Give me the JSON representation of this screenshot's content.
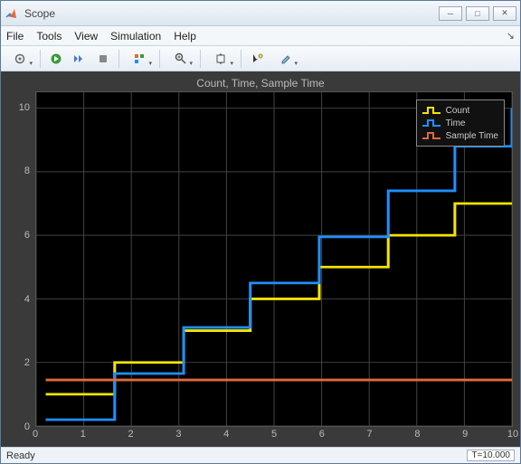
{
  "window": {
    "title": "Scope"
  },
  "menu": {
    "file": "File",
    "tools": "Tools",
    "view": "View",
    "simulation": "Simulation",
    "help": "Help"
  },
  "status": {
    "ready": "Ready",
    "time": "T=10.000"
  },
  "chart_data": {
    "type": "line",
    "title": "Count, Time, Sample Time",
    "xlabel": "",
    "ylabel": "",
    "xlim": [
      0,
      10
    ],
    "ylim": [
      0,
      10.5
    ],
    "xticks": [
      0,
      1,
      2,
      3,
      4,
      5,
      6,
      7,
      8,
      9,
      10
    ],
    "yticks": [
      0,
      2,
      4,
      6,
      8,
      10
    ],
    "legend_position": "top-right",
    "series": [
      {
        "name": "Count",
        "color": "#f4e400",
        "x": [
          0.2,
          1.65,
          1.65,
          3.1,
          3.1,
          4.5,
          4.5,
          5.95,
          5.95,
          7.4,
          7.4,
          8.8,
          8.8,
          10
        ],
        "y": [
          1.0,
          1.0,
          2.0,
          2.0,
          3.0,
          3.0,
          4.0,
          4.0,
          5.0,
          5.0,
          6.0,
          6.0,
          7.0,
          7.0
        ]
      },
      {
        "name": "Time",
        "color": "#1e90ff",
        "x": [
          0.2,
          1.65,
          1.65,
          3.1,
          3.1,
          4.5,
          4.5,
          5.95,
          5.95,
          7.4,
          7.4,
          8.8,
          8.8,
          10,
          10
        ],
        "y": [
          0.2,
          0.2,
          1.65,
          1.65,
          3.1,
          3.1,
          4.5,
          4.5,
          5.95,
          5.95,
          7.4,
          7.4,
          8.8,
          8.8,
          10
        ]
      },
      {
        "name": "Sample Time",
        "color": "#e06a3a",
        "x": [
          0.2,
          10
        ],
        "y": [
          1.45,
          1.45
        ]
      }
    ]
  }
}
